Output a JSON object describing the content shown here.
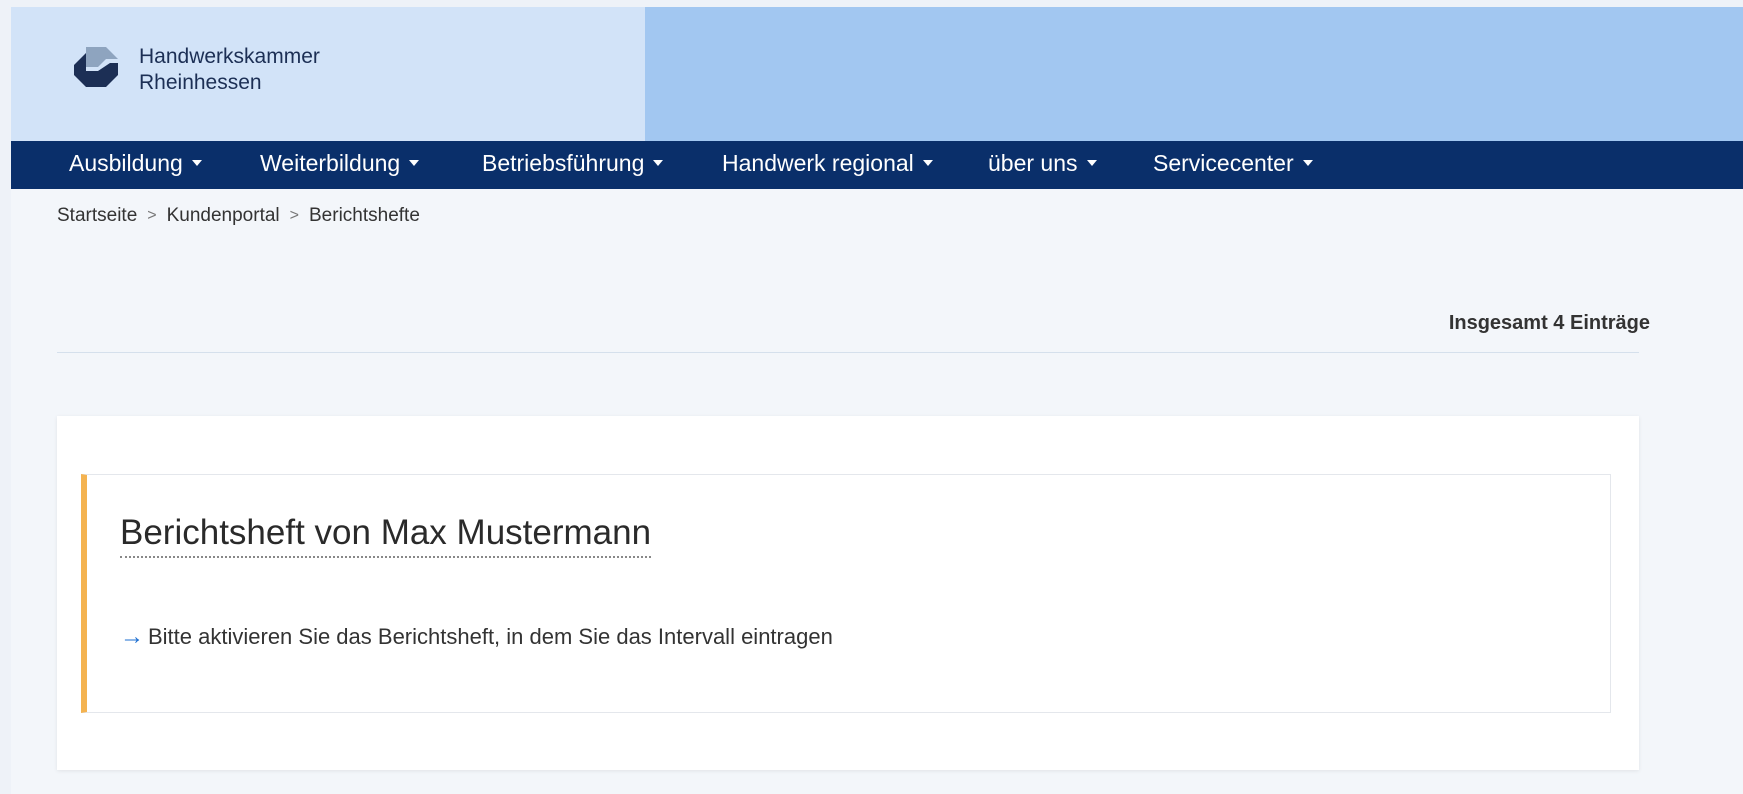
{
  "header": {
    "logo_line1": "Handwerkskammer",
    "logo_line2": "Rheinhessen",
    "logo_icon": "hwk-logo-icon"
  },
  "nav": {
    "items": [
      {
        "label": "Ausbildung"
      },
      {
        "label": "Weiterbildung"
      },
      {
        "label": "Betriebsführung"
      },
      {
        "label": "Handwerk regional"
      },
      {
        "label": "über uns"
      },
      {
        "label": "Servicecenter"
      }
    ]
  },
  "breadcrumb": {
    "items": [
      "Startseite",
      "Kundenportal",
      "Berichtshefte"
    ],
    "separator": ">"
  },
  "list": {
    "count_text": "Insgesamt 4 Einträge"
  },
  "entry": {
    "title": "Berichtsheft von Max Mustermann",
    "hint": "Bitte aktivieren Sie das Berichtsheft, in dem Sie das Intervall eintragen",
    "arrow_icon": "arrow-right-icon"
  },
  "colors": {
    "nav_bg": "#0a2f6a",
    "header_left_bg": "#d2e3f8",
    "header_right_bg": "#a2c7f1",
    "accent_bar": "#f4b350",
    "arrow": "#1e6fd1"
  }
}
